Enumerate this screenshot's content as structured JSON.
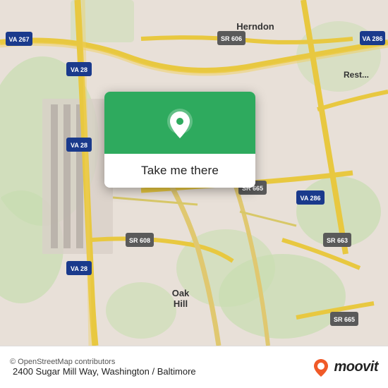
{
  "map": {
    "alt": "Map of Washington/Baltimore area showing 2400 Sugar Mill Way"
  },
  "popup": {
    "button_label": "Take me there"
  },
  "bottom_bar": {
    "attribution": "© OpenStreetMap contributors",
    "address": "2400 Sugar Mill Way, Washington / Baltimore",
    "logo_text": "moovit"
  }
}
